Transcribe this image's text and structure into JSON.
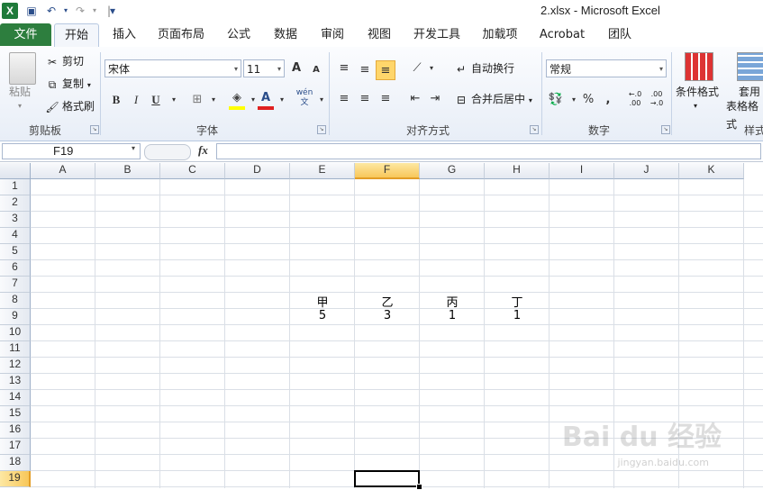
{
  "window": {
    "title": "2.xlsx  -  Microsoft Excel"
  },
  "quick_access": {
    "app_icon": "X",
    "save_icon": "💾",
    "undo_icon": "↶",
    "redo_icon": "↷",
    "customize_icon": "▾"
  },
  "ribbon_tabs": [
    "文件",
    "开始",
    "插入",
    "页面布局",
    "公式",
    "数据",
    "审阅",
    "视图",
    "开发工具",
    "加载项",
    "Acrobat",
    "团队"
  ],
  "clipboard": {
    "paste": "粘贴",
    "cut": "剪切",
    "copy": "复制",
    "format_painter": "格式刷",
    "group": "剪贴板"
  },
  "font": {
    "name": "宋体",
    "size": "11",
    "group": "字体",
    "bold": "B",
    "italic": "I",
    "underline": "U",
    "grow": "A",
    "shrink": "A",
    "color_a": "A",
    "wen": "wén\n文"
  },
  "alignment": {
    "wrap": "自动换行",
    "merge": "合并后居中",
    "group": "对齐方式"
  },
  "number": {
    "format": "常规",
    "group": "数字",
    "percent": "%",
    "comma": ",",
    "inc_decimal": "←.0\n.00",
    "dec_decimal": ".00\n→.0"
  },
  "styles": {
    "conditional": "条件格式",
    "table_line1": "套用",
    "table_line2": "表格格式",
    "group": "样式"
  },
  "formula_bar": {
    "name_box": "F19",
    "fx": "fx",
    "formula": ""
  },
  "columns": [
    "A",
    "B",
    "C",
    "D",
    "E",
    "F",
    "G",
    "H",
    "I",
    "J",
    "K"
  ],
  "rows": [
    "1",
    "2",
    "3",
    "4",
    "5",
    "6",
    "7",
    "8",
    "9",
    "10",
    "11",
    "12",
    "13",
    "14",
    "15",
    "16",
    "17",
    "18",
    "19"
  ],
  "cells": {
    "E8": "甲",
    "F8": "乙",
    "G8": "丙",
    "H8": "丁",
    "E9": "5",
    "F9": "3",
    "G9": "1",
    "H9": "1"
  },
  "watermark": {
    "main": "Bai du 经验",
    "sub": "jingyan.baidu.com"
  }
}
